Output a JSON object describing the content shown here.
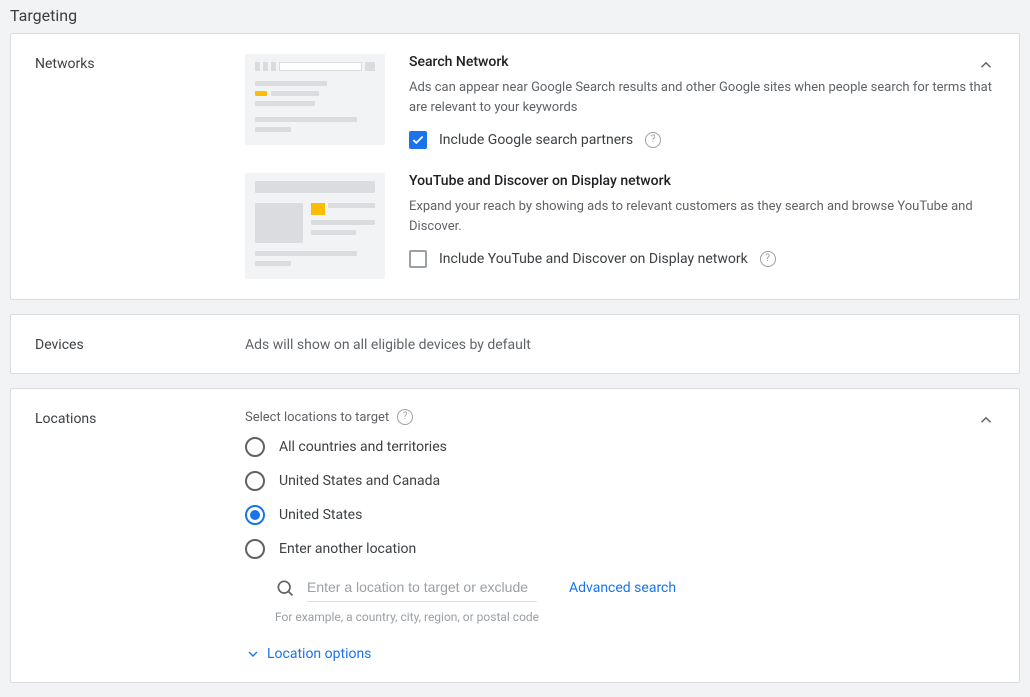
{
  "section_title": "Targeting",
  "networks": {
    "label": "Networks",
    "search": {
      "title": "Search Network",
      "desc": "Ads can appear near Google Search results and other Google sites when people search for terms that are relevant to your keywords",
      "checkbox_label": "Include Google search partners",
      "checked": true
    },
    "youtube": {
      "title": "YouTube and Discover on Display network",
      "desc": "Expand your reach by showing ads to relevant customers as they search and browse YouTube and Discover.",
      "checkbox_label": "Include YouTube and Discover on Display network",
      "checked": false
    }
  },
  "devices": {
    "label": "Devices",
    "text": "Ads will show on all eligible devices by default"
  },
  "locations": {
    "label": "Locations",
    "header": "Select locations to target",
    "options": {
      "all": "All countries and territories",
      "us_canada": "United States and Canada",
      "us": "United States",
      "other": "Enter another location"
    },
    "selected": "us",
    "input_placeholder": "Enter a location to target or exclude",
    "advanced_link": "Advanced search",
    "hint": "For example, a country, city, region, or postal code",
    "options_toggle": "Location options"
  }
}
